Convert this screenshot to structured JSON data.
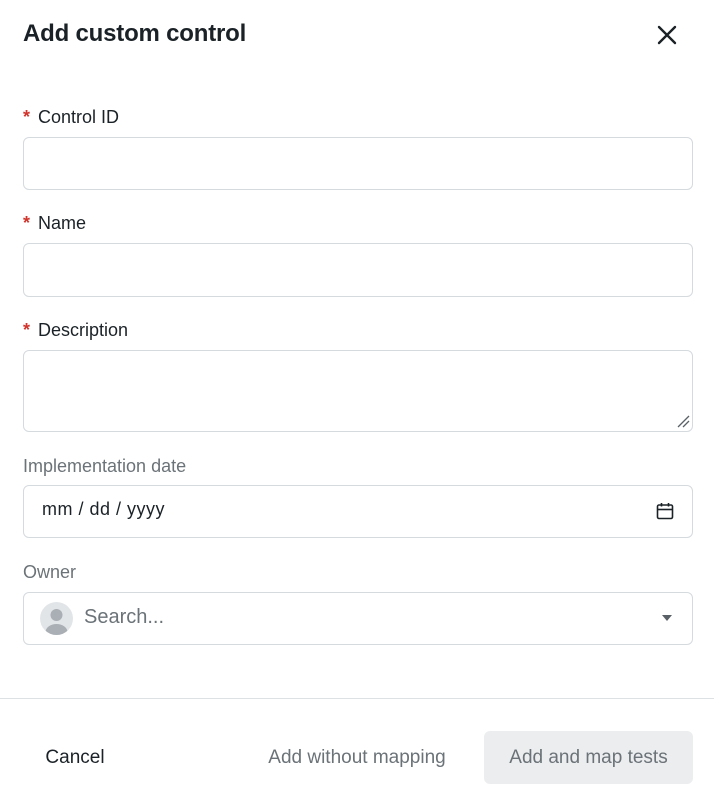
{
  "dialog": {
    "title": "Add custom control",
    "close_icon": "close-icon"
  },
  "fields": {
    "control_id": {
      "required_mark": "*",
      "label": "Control ID",
      "value": ""
    },
    "name": {
      "required_mark": "*",
      "label": "Name",
      "value": ""
    },
    "description": {
      "required_mark": "*",
      "label": "Description",
      "value": ""
    },
    "implementation_date": {
      "label": "Implementation date",
      "placeholder": "mm / dd / yyyy",
      "icon": "calendar-icon"
    },
    "owner": {
      "label": "Owner",
      "placeholder": "Search...",
      "avatar_icon": "user-avatar-icon",
      "dropdown_icon": "caret-down-icon"
    }
  },
  "footer": {
    "cancel_label": "Cancel",
    "add_without_mapping_label": "Add without mapping",
    "add_and_map_label": "Add and map tests"
  },
  "colors": {
    "required": "#d0342c",
    "text": "#1b2227",
    "muted": "#6b7378",
    "border": "#d5dade",
    "primary_button_disabled_bg": "#ecedef"
  }
}
